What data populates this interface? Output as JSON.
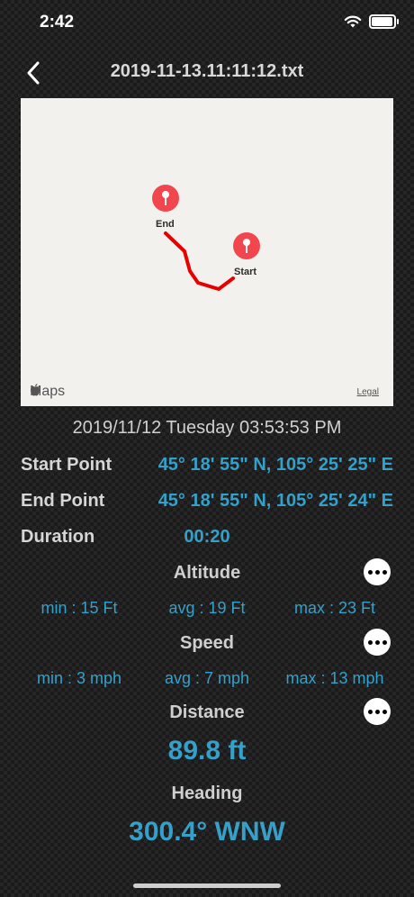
{
  "status": {
    "time": "2:42",
    "battery_level": 0.9
  },
  "nav": {
    "title": "2019-11-13.11:11:12.txt",
    "back_icon": "chevron-left-icon"
  },
  "map": {
    "maps_label": "Maps",
    "legal_label": "Legal",
    "start_label": "Start",
    "end_label": "End",
    "route_color": "#e60000",
    "pin_color": "#f2464f"
  },
  "summary": {
    "datetime": "2019/11/12 Tuesday 03:53:53 PM",
    "start_point_label": "Start Point",
    "start_point_value": "45° 18' 55\" N, 105° 25' 25\" E",
    "end_point_label": "End Point",
    "end_point_value": "45° 18' 55\" N, 105° 25' 24\" E",
    "duration_label": "Duration",
    "duration_value": "00:20"
  },
  "altitude": {
    "title": "Altitude",
    "min": "min : 15 Ft",
    "avg": "avg : 19 Ft",
    "max": "max : 23 Ft"
  },
  "speed": {
    "title": "Speed",
    "min": "min : 3 mph",
    "avg": "avg : 7 mph",
    "max": "max : 13 mph"
  },
  "distance": {
    "title": "Distance",
    "value": "89.8 ft"
  },
  "heading": {
    "title": "Heading",
    "value": "300.4° WNW"
  },
  "colors": {
    "accent": "#35a0c9"
  }
}
